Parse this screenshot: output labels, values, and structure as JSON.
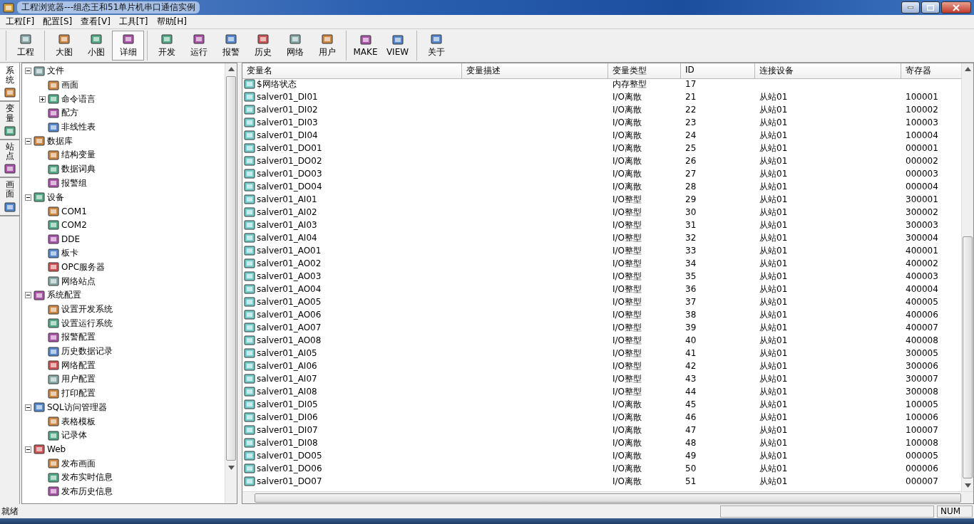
{
  "window": {
    "title": "工程浏览器---组态王和51单片机串口通信实例"
  },
  "menu": [
    "工程[F]",
    "配置[S]",
    "查看[V]",
    "工具[T]",
    "帮助[H]"
  ],
  "toolbar": [
    {
      "buttons": [
        {
          "label": "工程",
          "selected": false
        }
      ]
    },
    {
      "buttons": [
        {
          "label": "大图",
          "selected": false
        },
        {
          "label": "小图",
          "selected": false
        },
        {
          "label": "详细",
          "selected": true
        }
      ]
    },
    {
      "buttons": [
        {
          "label": "开发",
          "selected": false
        },
        {
          "label": "运行",
          "selected": false
        },
        {
          "label": "报警",
          "selected": false
        },
        {
          "label": "历史",
          "selected": false
        },
        {
          "label": "网络",
          "selected": false
        },
        {
          "label": "用户",
          "selected": false
        }
      ]
    },
    {
      "buttons": [
        {
          "label": "MAKE",
          "selected": false
        },
        {
          "label": "VIEW",
          "selected": false
        }
      ]
    },
    {
      "buttons": [
        {
          "label": "关于",
          "selected": false
        }
      ]
    }
  ],
  "side_tabs": [
    {
      "label": "系统",
      "selected": true
    },
    {
      "label": "变量",
      "selected": false
    },
    {
      "label": "站点",
      "selected": false
    },
    {
      "label": "画面",
      "selected": false
    }
  ],
  "tree": [
    {
      "label": "文件",
      "expanded": true,
      "children": [
        {
          "label": "画面"
        },
        {
          "label": "命令语言",
          "expanded": false
        },
        {
          "label": "配方"
        },
        {
          "label": "非线性表"
        }
      ]
    },
    {
      "label": "数据库",
      "expanded": true,
      "children": [
        {
          "label": "结构变量"
        },
        {
          "label": "数据词典"
        },
        {
          "label": "报警组"
        }
      ]
    },
    {
      "label": "设备",
      "expanded": true,
      "children": [
        {
          "label": "COM1"
        },
        {
          "label": "COM2"
        },
        {
          "label": "DDE"
        },
        {
          "label": "板卡"
        },
        {
          "label": "OPC服务器"
        },
        {
          "label": "网络站点"
        }
      ]
    },
    {
      "label": "系统配置",
      "expanded": true,
      "children": [
        {
          "label": "设置开发系统"
        },
        {
          "label": "设置运行系统"
        },
        {
          "label": "报警配置"
        },
        {
          "label": "历史数据记录"
        },
        {
          "label": "网络配置"
        },
        {
          "label": "用户配置"
        },
        {
          "label": "打印配置"
        }
      ]
    },
    {
      "label": "SQL访问管理器",
      "expanded": true,
      "children": [
        {
          "label": "表格模板"
        },
        {
          "label": "记录体"
        }
      ]
    },
    {
      "label": "Web",
      "expanded": true,
      "children": [
        {
          "label": "发布画面"
        },
        {
          "label": "发布实时信息"
        },
        {
          "label": "发布历史信息"
        }
      ]
    }
  ],
  "table": {
    "columns": [
      "变量名",
      "变量描述",
      "变量类型",
      "ID",
      "连接设备",
      "寄存器"
    ],
    "rows": [
      [
        "$网络状态",
        "",
        "内存整型",
        "17",
        "",
        ""
      ],
      [
        "salver01_DI01",
        "",
        "I/O离散",
        "21",
        "从站01",
        "100001"
      ],
      [
        "salver01_DI02",
        "",
        "I/O离散",
        "22",
        "从站01",
        "100002"
      ],
      [
        "salver01_DI03",
        "",
        "I/O离散",
        "23",
        "从站01",
        "100003"
      ],
      [
        "salver01_DI04",
        "",
        "I/O离散",
        "24",
        "从站01",
        "100004"
      ],
      [
        "salver01_DO01",
        "",
        "I/O离散",
        "25",
        "从站01",
        "000001"
      ],
      [
        "salver01_DO02",
        "",
        "I/O离散",
        "26",
        "从站01",
        "000002"
      ],
      [
        "salver01_DO03",
        "",
        "I/O离散",
        "27",
        "从站01",
        "000003"
      ],
      [
        "salver01_DO04",
        "",
        "I/O离散",
        "28",
        "从站01",
        "000004"
      ],
      [
        "salver01_AI01",
        "",
        "I/O整型",
        "29",
        "从站01",
        "300001"
      ],
      [
        "salver01_AI02",
        "",
        "I/O整型",
        "30",
        "从站01",
        "300002"
      ],
      [
        "salver01_AI03",
        "",
        "I/O整型",
        "31",
        "从站01",
        "300003"
      ],
      [
        "salver01_AI04",
        "",
        "I/O整型",
        "32",
        "从站01",
        "300004"
      ],
      [
        "salver01_AO01",
        "",
        "I/O整型",
        "33",
        "从站01",
        "400001"
      ],
      [
        "salver01_AO02",
        "",
        "I/O整型",
        "34",
        "从站01",
        "400002"
      ],
      [
        "salver01_AO03",
        "",
        "I/O整型",
        "35",
        "从站01",
        "400003"
      ],
      [
        "salver01_AO04",
        "",
        "I/O整型",
        "36",
        "从站01",
        "400004"
      ],
      [
        "salver01_AO05",
        "",
        "I/O整型",
        "37",
        "从站01",
        "400005"
      ],
      [
        "salver01_AO06",
        "",
        "I/O整型",
        "38",
        "从站01",
        "400006"
      ],
      [
        "salver01_AO07",
        "",
        "I/O整型",
        "39",
        "从站01",
        "400007"
      ],
      [
        "salver01_AO08",
        "",
        "I/O整型",
        "40",
        "从站01",
        "400008"
      ],
      [
        "salver01_AI05",
        "",
        "I/O整型",
        "41",
        "从站01",
        "300005"
      ],
      [
        "salver01_AI06",
        "",
        "I/O整型",
        "42",
        "从站01",
        "300006"
      ],
      [
        "salver01_AI07",
        "",
        "I/O整型",
        "43",
        "从站01",
        "300007"
      ],
      [
        "salver01_AI08",
        "",
        "I/O整型",
        "44",
        "从站01",
        "300008"
      ],
      [
        "salver01_DI05",
        "",
        "I/O离散",
        "45",
        "从站01",
        "100005"
      ],
      [
        "salver01_DI06",
        "",
        "I/O离散",
        "46",
        "从站01",
        "100006"
      ],
      [
        "salver01_DI07",
        "",
        "I/O离散",
        "47",
        "从站01",
        "100007"
      ],
      [
        "salver01_DI08",
        "",
        "I/O离散",
        "48",
        "从站01",
        "100008"
      ],
      [
        "salver01_DO05",
        "",
        "I/O离散",
        "49",
        "从站01",
        "000005"
      ],
      [
        "salver01_DO06",
        "",
        "I/O离散",
        "50",
        "从站01",
        "000006"
      ],
      [
        "salver01_DO07",
        "",
        "I/O离散",
        "51",
        "从站01",
        "000007"
      ]
    ]
  },
  "status_bar": {
    "message": "就绪",
    "indicator": "NUM"
  }
}
